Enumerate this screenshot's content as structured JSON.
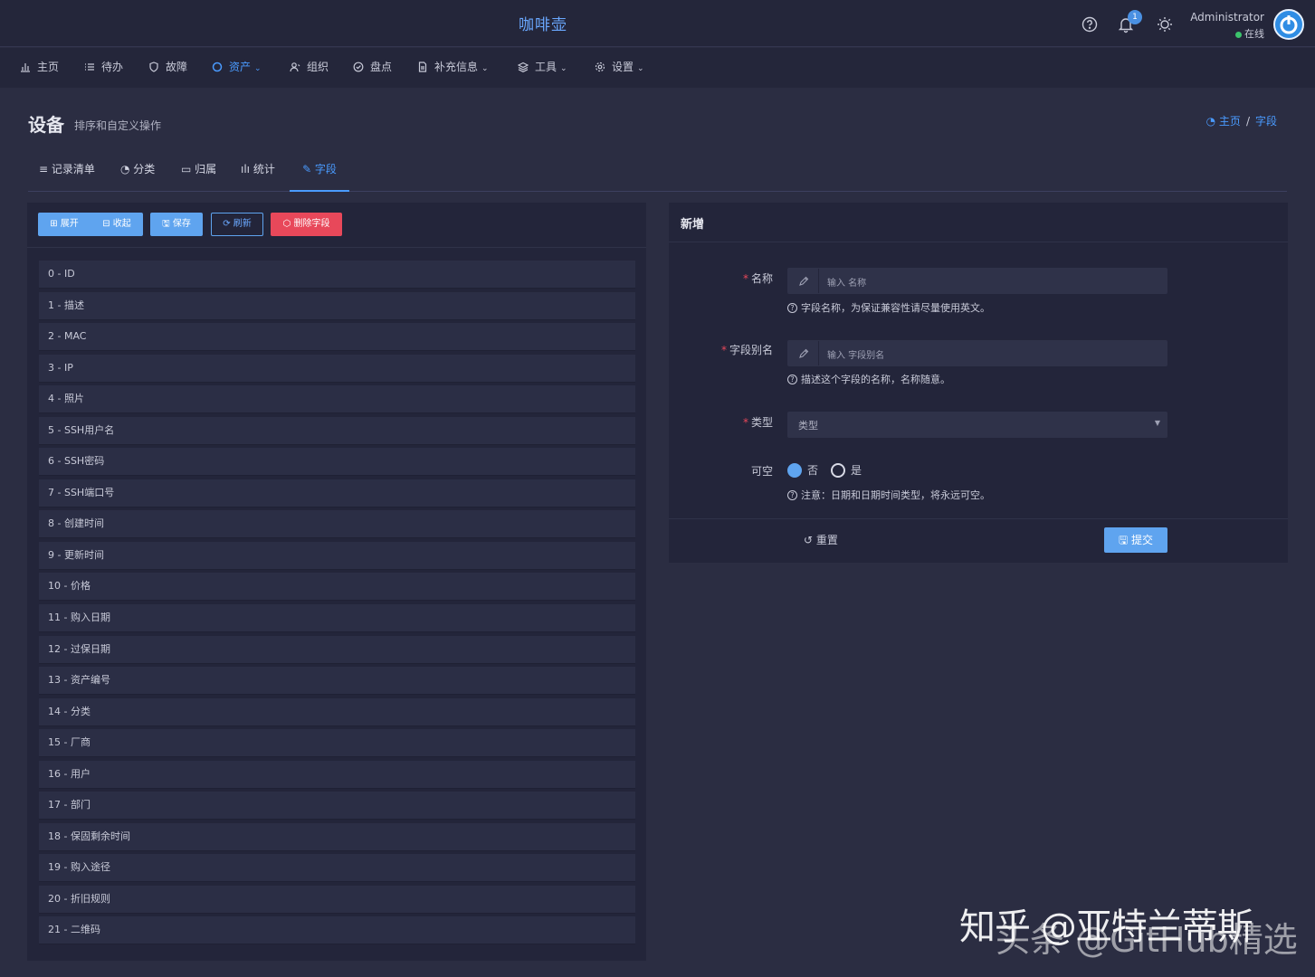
{
  "header": {
    "app_title": "咖啡壶",
    "notification_count": "1",
    "user_name": "Administrator",
    "user_status": "在线"
  },
  "nav": [
    {
      "label": "主页",
      "icon": "bar-chart-icon"
    },
    {
      "label": "待办",
      "icon": "list-icon"
    },
    {
      "label": "故障",
      "icon": "shield-icon"
    },
    {
      "label": "资产",
      "icon": "circle-icon",
      "active": true
    },
    {
      "label": "组织",
      "icon": "user-icon"
    },
    {
      "label": "盘点",
      "icon": "check-circle-icon"
    },
    {
      "label": "补充信息",
      "icon": "file-icon"
    },
    {
      "label": "工具",
      "icon": "layers-icon"
    },
    {
      "label": "设置",
      "icon": "gear-icon"
    }
  ],
  "page": {
    "title": "设备",
    "subtitle": "排序和自定义操作",
    "breadcrumb_home": "主页",
    "breadcrumb_sep": "/",
    "breadcrumb_current": "字段"
  },
  "tabs": [
    {
      "label": "≡ 记录清单"
    },
    {
      "label": "◔ 分类"
    },
    {
      "label": "▭ 归属"
    },
    {
      "label": "ılı 统计"
    },
    {
      "label": "✎ 字段",
      "active": true
    }
  ],
  "toolbar": {
    "expand": "⊞ 展开",
    "collapse": "⊟ 收起",
    "save": "🖫 保存",
    "refresh": "⟳ 刷新",
    "delete": "⬡ 删除字段"
  },
  "fields": [
    "0 - ID",
    "1 - 描述",
    "2 - MAC",
    "3 - IP",
    "4 - 照片",
    "5 - SSH用户名",
    "6 - SSH密码",
    "7 - SSH端口号",
    "8 - 创建时间",
    "9 - 更新时间",
    "10 - 价格",
    "11 - 购入日期",
    "12 - 过保日期",
    "13 - 资产编号",
    "14 - 分类",
    "15 - 厂商",
    "16 - 用户",
    "17 - 部门",
    "18 - 保固剩余时间",
    "19 - 购入途径",
    "20 - 折旧规则",
    "21 - 二维码"
  ],
  "form": {
    "title": "新增",
    "name_label": "名称",
    "name_placeholder": "输入 名称",
    "name_help": "字段名称，为保证兼容性请尽量使用英文。",
    "alias_label": "字段别名",
    "alias_placeholder": "输入 字段别名",
    "alias_help": "描述这个字段的名称，名称随意。",
    "type_label": "类型",
    "type_value": "类型",
    "nullable_label": "可空",
    "nullable_no": "否",
    "nullable_yes": "是",
    "nullable_value": "否",
    "nullable_help": "注意：日期和日期时间类型，将永远可空。",
    "reset": "重置",
    "submit": "提交"
  },
  "watermark": {
    "line1": "知乎 @亚特兰蒂斯",
    "line2": "头条 @GitHub精选"
  },
  "colors": {
    "background": "#2b2d42",
    "panel": "#23253a",
    "accent": "#4a9bff",
    "danger": "#e8485a",
    "online": "#3cc36c"
  }
}
